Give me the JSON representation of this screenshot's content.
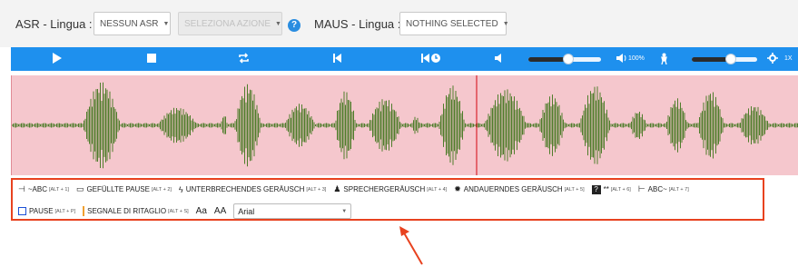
{
  "asr": {
    "label": "ASR - Lingua :",
    "select_value": "NESSUN ASR",
    "second_select_value": "SELEZIONA AZIONE"
  },
  "maus": {
    "label": "MAUS - Lingua :",
    "select_value": "NOTHING SELECTED"
  },
  "player": {
    "icons": [
      "play-icon",
      "stop-icon",
      "loop-icon",
      "skip-to-start-icon",
      "skip-back-5s-icon",
      "volume-icon",
      "volume-100-icon",
      "speed-icon",
      "settings-icon"
    ],
    "volume_level": 0.55,
    "volume_text": "100%",
    "speed_level": 0.6,
    "speed_text": "1X"
  },
  "annotations": {
    "row1": [
      {
        "label": "~ABC",
        "shortcut": "[ALT + 1]",
        "icon": "marker-start-icon"
      },
      {
        "label": "GEFÜLLTE PAUSE",
        "shortcut": "[ALT + 2]",
        "icon": "speech-bubble-icon"
      },
      {
        "label": "UNTERBRECHENDES GERÄUSCH",
        "shortcut": "[ALT + 3]",
        "icon": "lightning-icon"
      },
      {
        "label": "SPRECHERGERÄUSCH",
        "shortcut": "[ALT + 4]",
        "icon": "person-icon"
      },
      {
        "label": "ANDAUERNDES GERÄUSCH",
        "shortcut": "[ALT + 5]",
        "icon": "burst-icon"
      },
      {
        "label": "**",
        "shortcut": "[ALT + 6]",
        "icon": "question-box-icon"
      },
      {
        "label": "ABC~",
        "shortcut": "[ALT + 7]",
        "icon": "marker-end-icon"
      }
    ],
    "row2": [
      {
        "label": "PAUSE",
        "shortcut": "[ALT + P]",
        "icon": "square-icon"
      },
      {
        "label": "SEGNALE DI RITAGLIO",
        "shortcut": "[ALT + S]",
        "icon": "crop-bar-icon"
      }
    ],
    "font_decrease": "Aa",
    "font_increase": "AA",
    "font_family": "Arial"
  }
}
